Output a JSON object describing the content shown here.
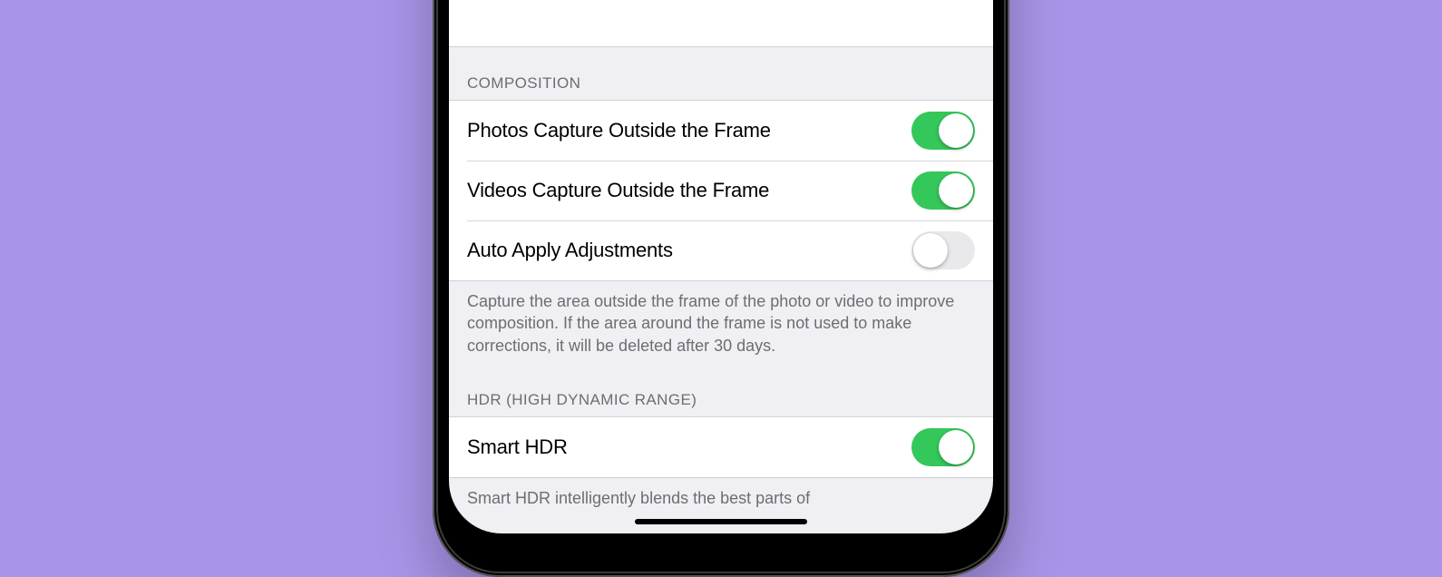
{
  "colors": {
    "background": "#a995e8",
    "toggle_on": "#34c759",
    "toggle_off": "#e9e9eb"
  },
  "sections": {
    "composition": {
      "header": "COMPOSITION",
      "rows": {
        "photos_capture": {
          "label": "Photos Capture Outside the Frame",
          "on": true
        },
        "videos_capture": {
          "label": "Videos Capture Outside the Frame",
          "on": true
        },
        "auto_apply": {
          "label": "Auto Apply Adjustments",
          "on": false
        }
      },
      "footer": "Capture the area outside the frame of the photo or video to improve composition. If the area around the frame is not used to make corrections, it will be deleted after 30 days."
    },
    "hdr": {
      "header": "HDR (HIGH DYNAMIC RANGE)",
      "rows": {
        "smart_hdr": {
          "label": "Smart HDR",
          "on": true
        }
      },
      "footer": "Smart HDR intelligently blends the best parts of"
    }
  }
}
